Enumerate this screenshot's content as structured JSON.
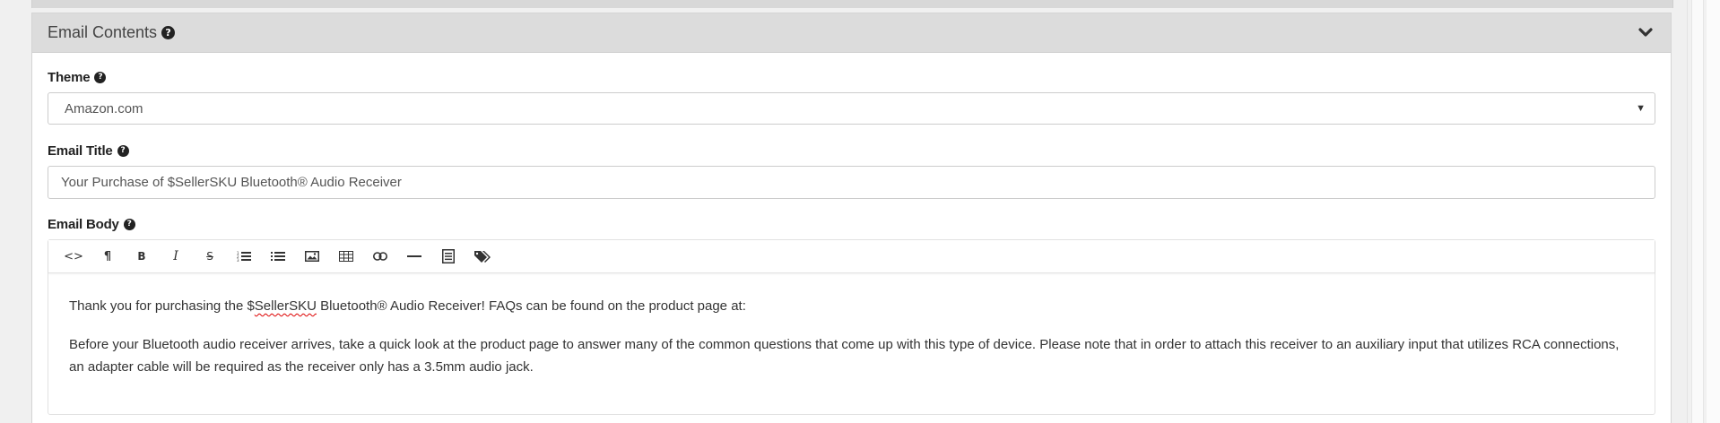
{
  "panel": {
    "title": "Email Contents",
    "help_icon": "question-circle-icon",
    "toggle_icon": "chevron-down-icon"
  },
  "theme": {
    "label": "Theme",
    "selected": "Amazon.com",
    "arrow": "▼"
  },
  "email_title": {
    "label": "Email Title",
    "value": "Your Purchase of $SellerSKU Bluetooth® Audio Receiver"
  },
  "email_body": {
    "label": "Email Body",
    "toolbar": [
      {
        "name": "code-view-icon",
        "glyph": "<>"
      },
      {
        "name": "paragraph-icon",
        "glyph": "¶"
      },
      {
        "name": "bold-icon",
        "glyph": "B"
      },
      {
        "name": "italic-icon",
        "glyph": "I"
      },
      {
        "name": "strikethrough-icon",
        "glyph": "S"
      },
      {
        "name": "ordered-list-icon",
        "glyph": ""
      },
      {
        "name": "unordered-list-icon",
        "glyph": ""
      },
      {
        "name": "image-icon",
        "glyph": ""
      },
      {
        "name": "table-icon",
        "glyph": ""
      },
      {
        "name": "link-icon",
        "glyph": ""
      },
      {
        "name": "horizontal-rule-icon",
        "glyph": ""
      },
      {
        "name": "align-icon",
        "glyph": ""
      },
      {
        "name": "tags-icon",
        "glyph": ""
      }
    ],
    "paragraph1_before": "Thank you for purchasing the  $",
    "paragraph1_spell": "SellerSKU",
    "paragraph1_after": " Bluetooth® Audio Receiver! FAQs can be found on the product page at:",
    "paragraph2": "Before your Bluetooth audio receiver arrives, take a quick look at the product page to answer many of the common questions that come up with this type of device. Please note that in order to attach this receiver to an auxiliary input that utilizes RCA connections, an adapter cable will be required as the receiver only has a 3.5mm audio jack."
  },
  "colors": {
    "header_bg": "#dcdcdc",
    "panel_bg": "#ffffff",
    "border": "#cccccc",
    "text": "#333333",
    "spell_underline": "#dd0000"
  }
}
